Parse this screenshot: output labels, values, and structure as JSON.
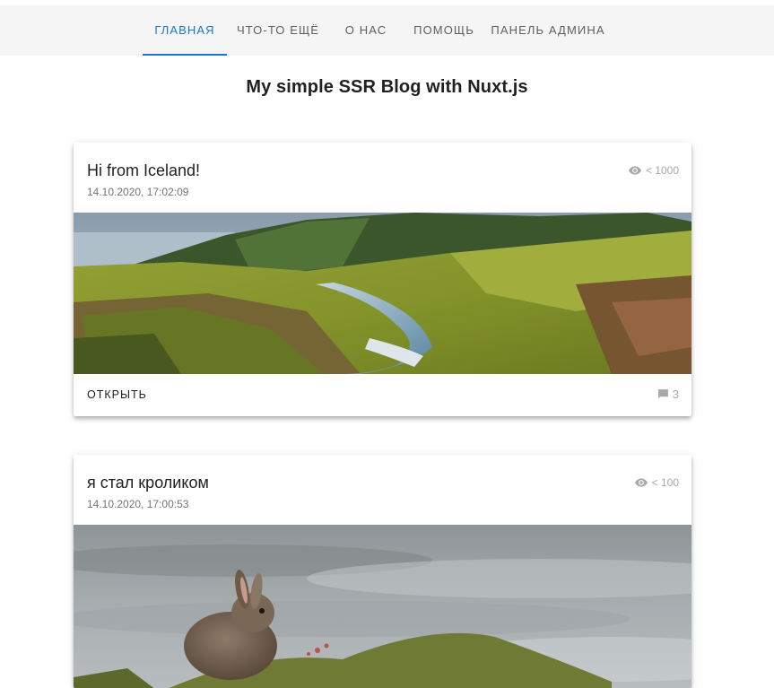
{
  "nav": {
    "tabs": [
      {
        "label": "ГЛАВНАЯ",
        "active": true
      },
      {
        "label": "ЧТО-ТО ЕЩЁ"
      },
      {
        "label": "О НАС"
      },
      {
        "label": "ПОМОЩЬ"
      },
      {
        "label": "ПАНЕЛЬ АДМИНА"
      }
    ],
    "accent_color": "#1976d2"
  },
  "page": {
    "title": "My simple SSR Blog with Nuxt.js"
  },
  "posts": [
    {
      "title": "Hi from Iceland!",
      "date": "14.10.2020, 17:02:09",
      "views": "< 1000",
      "image": "iceland-landscape",
      "open_label": "ОТКРЫТЬ",
      "comments": "3"
    },
    {
      "title": "я стал кроликом",
      "date": "14.10.2020, 17:00:53",
      "views": "< 100",
      "image": "rabbit-photo"
    }
  ],
  "icons": {
    "views": "eye-icon",
    "comments": "comment-icon"
  }
}
